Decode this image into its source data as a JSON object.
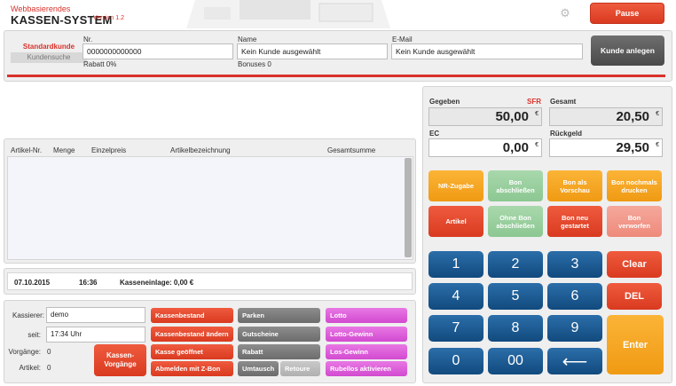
{
  "header": {
    "brand_top": "Webbasierendes",
    "brand_main": "KASSEN-SYSTEM",
    "version": "Version 1.2",
    "pause_label": "Pause"
  },
  "customer": {
    "tab_standard": "Standardkunde",
    "tab_search": "Kundensuche",
    "nr_label": "Nr.",
    "nr_value": "0000000000000",
    "discount": "Rabatt 0%",
    "name_label": "Name",
    "name_value": "Kein Kunde ausgewählt",
    "bonuses": "Bonuses 0",
    "email_label": "E-Mail",
    "email_value": "Kein Kunde ausgewählt",
    "add_button": "Kunde anlegen"
  },
  "table": {
    "columns": [
      "Artikel-Nr.",
      "Menge",
      "Einzelpreis",
      "Artikelbezeichnung",
      "Gesamtsumme"
    ]
  },
  "info": {
    "date": "07.10.2015",
    "time": "16:36",
    "deposit": "Kasseneinlage: 0,00 €"
  },
  "cashier": {
    "cashier_label": "Kassierer:",
    "cashier_value": "demo",
    "since_label": "seit:",
    "since_value": "17:34 Uhr",
    "transactions_label": "Vorgänge:",
    "transactions_value": "0",
    "articles_label": "Artikel:",
    "articles_value": "0",
    "transactions_button": "Kassen-\nVorgänge"
  },
  "actions": {
    "col1": [
      "Kassenbestand",
      "Kassenbestand ändern",
      "Kasse geöffnet",
      "Abmelden mit Z-Bon"
    ],
    "col2": [
      "Parken",
      "Gutscheine",
      "Rabatt",
      "Umtausch",
      "Retoure"
    ],
    "col3": [
      "Lotto",
      "Lotto-Gewinn",
      "Los-Gewinn",
      "Rubellos aktivieren"
    ]
  },
  "totals": {
    "given_label": "Gegeben",
    "currency_code": "SFR",
    "given_value": "50,00",
    "total_label": "Gesamt",
    "total_value": "20,50",
    "ec_label": "EC",
    "ec_value": "0,00",
    "change_label": "Rückgeld",
    "change_value": "29,50",
    "currency_symbol": "€"
  },
  "functions": {
    "row1": [
      "NR-Zugabe",
      "Bon\nabschließen",
      "Bon als\nVorschau",
      "Bon nochmals\ndrucken"
    ],
    "row2": [
      "Artikel",
      "Ohne Bon\nabschließen",
      "Bon neu\ngestartet",
      "Bon\nverworfen"
    ]
  },
  "keypad": {
    "digits": [
      "1",
      "2",
      "3",
      "4",
      "5",
      "6",
      "7",
      "8",
      "9",
      "0",
      "00"
    ],
    "backspace": "⟵",
    "clear": "Clear",
    "del": "DEL",
    "enter": "Enter"
  },
  "colors": {
    "accent_red": "#d9322b",
    "keypad_blue": "#1d5b93",
    "orange": "#f5a623",
    "green": "#8cc792",
    "pink": "#d24ad0"
  }
}
